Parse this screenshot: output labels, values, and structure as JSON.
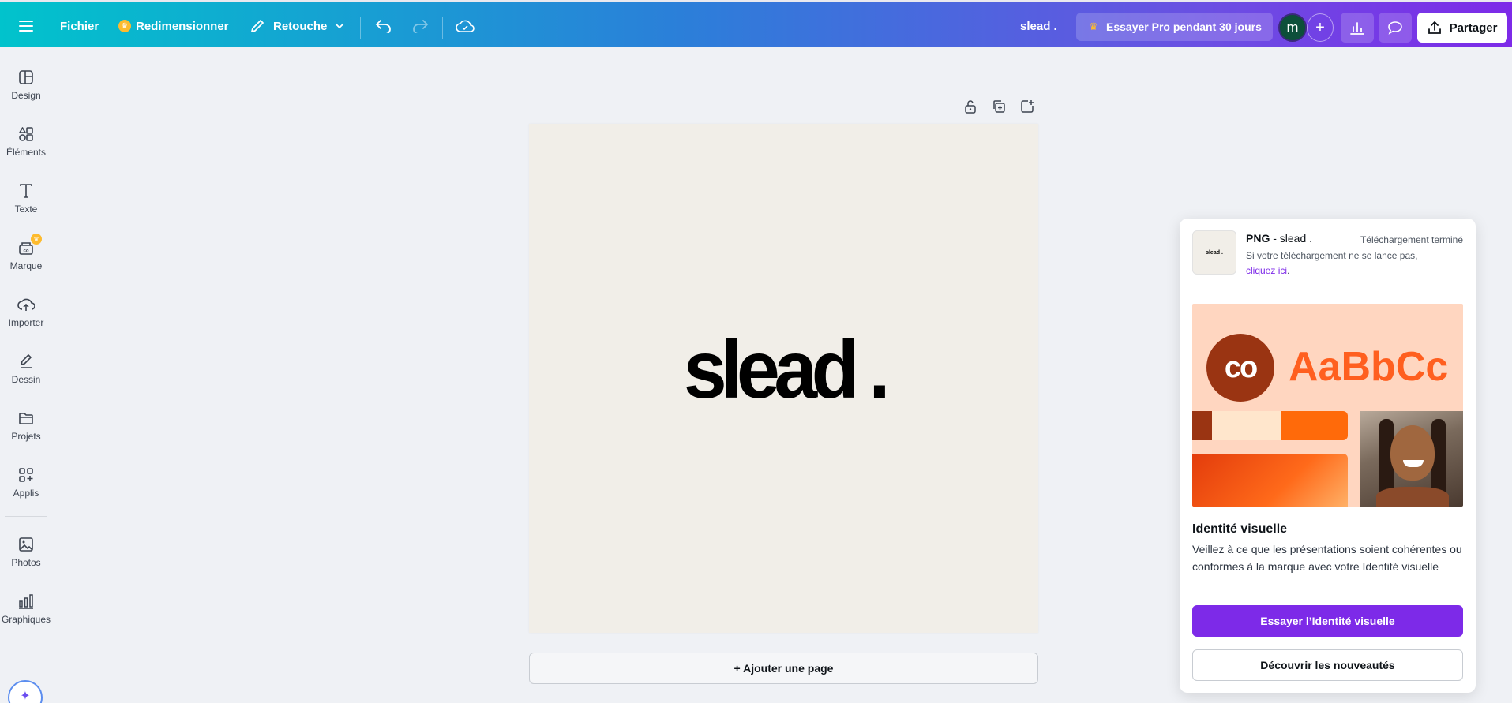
{
  "topbar": {
    "file_label": "Fichier",
    "resize_label": "Redimensionner",
    "retouche_label": "Retouche",
    "doc_title": "slead .",
    "pro_label": "Essayer Pro pendant 30 jours",
    "avatar_initial": "m",
    "plus_label": "+",
    "share_label": "Partager"
  },
  "sidebar": {
    "items": [
      {
        "label": "Design",
        "icon": "layout-icon"
      },
      {
        "label": "Éléments",
        "icon": "shapes-icon"
      },
      {
        "label": "Texte",
        "icon": "text-icon"
      },
      {
        "label": "Marque",
        "icon": "brand-icon"
      },
      {
        "label": "Importer",
        "icon": "upload-cloud-icon"
      },
      {
        "label": "Dessin",
        "icon": "pen-icon"
      },
      {
        "label": "Projets",
        "icon": "folder-icon"
      },
      {
        "label": "Applis",
        "icon": "apps-icon"
      },
      {
        "label": "Photos",
        "icon": "image-icon"
      },
      {
        "label": "Graphiques",
        "icon": "chart-icon"
      }
    ]
  },
  "canvas": {
    "logo_text": "slead .",
    "background": "#f1eee8",
    "add_page_label": "+ Ajouter une page"
  },
  "panel": {
    "thumb_text": "slead .",
    "file_type": "PNG",
    "file_name": " - slead .",
    "status": "Téléchargement terminé",
    "hint_prefix": "Si votre téléchargement ne se lance pas, ",
    "hint_link": "cliquez ici",
    "hint_suffix": ".",
    "promo_logo": "co",
    "promo_type": "AaBbCc",
    "identity_title": "Identité visuelle",
    "identity_desc": "Veillez à ce que les présentations soient cohérentes ou conformes à la marque avec votre Identité visuelle",
    "primary_label": "Essayer l’Identité visuelle",
    "secondary_label": "Découvrir les nouveautés"
  },
  "colors": {
    "accent": "#7d2ae8",
    "gradient_start": "#01c3cc",
    "gradient_end": "#7d2ae8",
    "promo_orange": "#ff5f1f",
    "promo_brown": "#9a3412"
  }
}
